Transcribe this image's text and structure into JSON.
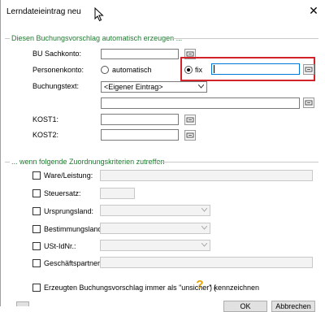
{
  "window": {
    "title": "Lerndateieintrag neu"
  },
  "group1": {
    "title": "Diesen Buchungsvorschlag automatisch erzeugen ...",
    "bu_sachkonto_label": "BU Sachkonto:",
    "personenkonto_label": "Personenkonto:",
    "radio_automatisch": "automatisch",
    "radio_fix": "fix",
    "fix_value": "",
    "buchungstext_label": "Buchungstext:",
    "buchungstext_selected": "<Eigener Eintrag>",
    "kost1_label": "KOST1:",
    "kost2_label": "KOST2:"
  },
  "group2": {
    "title": "... wenn folgende Zuordnungskriterien zutreffen",
    "criteria": [
      "Ware/Leistung:",
      "Steuersatz:",
      "Ursprungsland:",
      "Bestimmungsland:",
      "USt-IdNr.:",
      "Geschäftspartner:"
    ]
  },
  "footer": {
    "unsicher_text_before": "Erzeugten Buchungsvorschlag immer als \"unsicher\" (",
    "unsicher_text_after": ") kennzeichnen",
    "ok_label": "OK",
    "cancel_label": "Abbrechen"
  },
  "colors": {
    "group_title": "#1e7a2e",
    "highlight": "#d2232a",
    "help_icon": "#e6a300"
  }
}
